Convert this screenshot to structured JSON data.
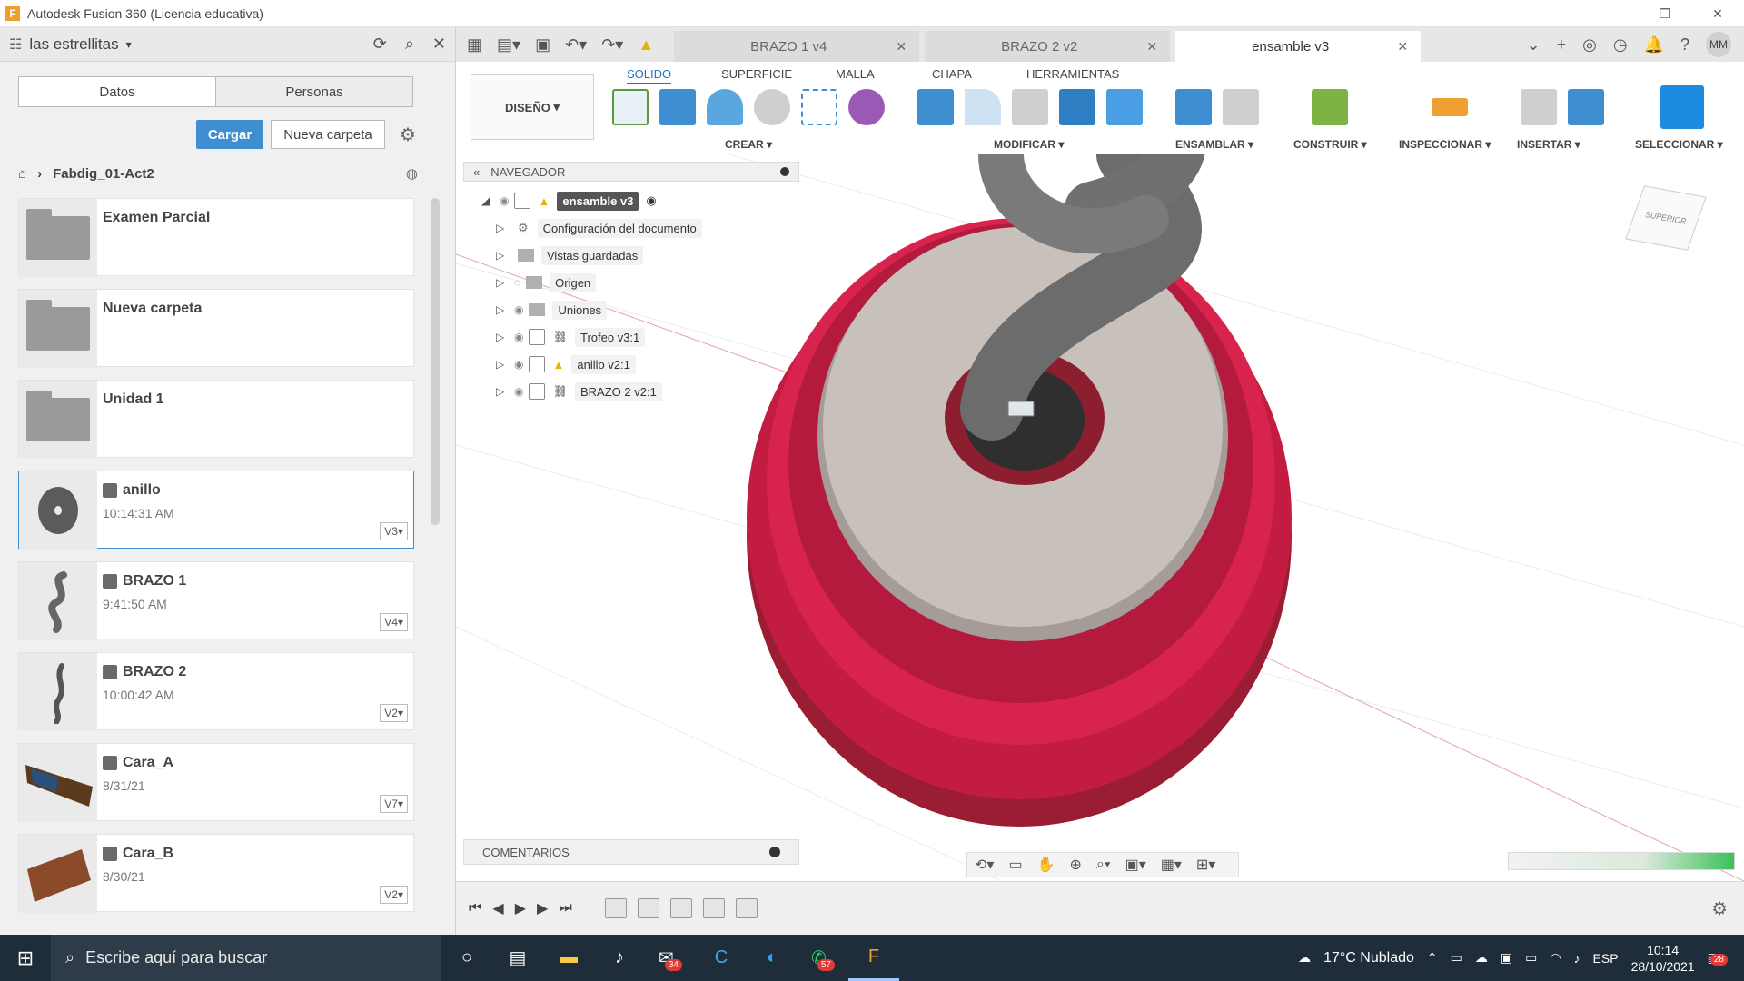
{
  "window": {
    "title": "Autodesk Fusion 360 (Licencia educativa)"
  },
  "left_panel": {
    "team": "las estrellitas",
    "tabs": [
      "Datos",
      "Personas"
    ],
    "buttons": {
      "upload": "Cargar",
      "new_folder": "Nueva carpeta"
    },
    "breadcrumb": "Fabdig_01-Act2",
    "items": [
      {
        "name": "Examen Parcial",
        "kind": "folder",
        "time": "",
        "version": ""
      },
      {
        "name": "Nueva carpeta",
        "kind": "folder",
        "time": "",
        "version": ""
      },
      {
        "name": "Unidad 1",
        "kind": "folder",
        "time": "",
        "version": ""
      },
      {
        "name": "anillo",
        "kind": "design",
        "time": "10:14:31 AM",
        "version": "V3"
      },
      {
        "name": "BRAZO 1",
        "kind": "design",
        "time": "9:41:50 AM",
        "version": "V4"
      },
      {
        "name": "BRAZO 2",
        "kind": "design",
        "time": "10:00:42 AM",
        "version": "V2"
      },
      {
        "name": "Cara_A",
        "kind": "design",
        "time": "8/31/21",
        "version": "V7"
      },
      {
        "name": "Cara_B",
        "kind": "design",
        "time": "8/30/21",
        "version": "V2"
      }
    ]
  },
  "doc_tabs": [
    {
      "label": "BRAZO 1 v4",
      "active": false
    },
    {
      "label": "BRAZO 2 v2",
      "active": false
    },
    {
      "label": "ensamble v3",
      "active": true
    }
  ],
  "ribbon": {
    "workspace": "DISEÑO",
    "tabs": [
      "SOLIDO",
      "SUPERFICIE",
      "MALLA",
      "CHAPA",
      "HERRAMIENTAS"
    ],
    "groups": [
      "CREAR",
      "MODIFICAR",
      "ENSAMBLAR",
      "CONSTRUIR",
      "INSPECCIONAR",
      "INSERTAR",
      "SELECCIONAR"
    ]
  },
  "navigator": {
    "title": "NAVEGADOR",
    "root": "ensamble v3",
    "items": [
      "Configuración del documento",
      "Vistas guardadas",
      "Origen",
      "Uniones",
      "Trofeo v3:1",
      "anillo v2:1",
      "BRAZO 2 v2:1"
    ]
  },
  "viewcube": "SUPERIOR",
  "comments_label": "COMENTARIOS",
  "taskbar": {
    "search": "Escribe aquí para buscar",
    "weather": "17°C Nublado",
    "lang": "ESP",
    "time": "10:14",
    "date": "28/10/2021",
    "badge_mail": "34",
    "badge_whatsapp": "57",
    "badge_notif": "28"
  },
  "colors": {
    "accent": "#3f8ed1",
    "model_red": "#d2204a",
    "model_gray": "#7a7a7a"
  }
}
